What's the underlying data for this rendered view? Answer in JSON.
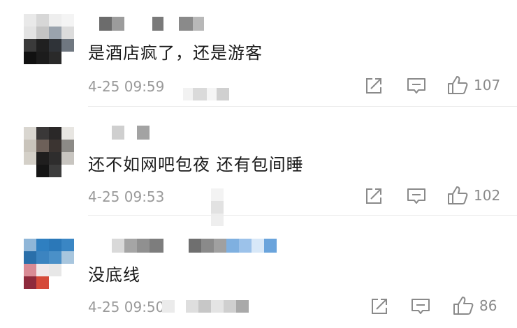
{
  "comments": [
    {
      "text": "是酒店疯了，还是游客",
      "time": "4-25 09:59",
      "likes": "107"
    },
    {
      "text": "还不如网吧包夜 还有包间睡",
      "time": "4-25 09:53",
      "likes": "102"
    },
    {
      "text": "没底线",
      "time": "4-25 09:50",
      "likes": "86"
    }
  ],
  "icons": {
    "repost": "repost-icon",
    "comment": "comment-icon",
    "like": "thumbs-up-icon"
  },
  "colors": {
    "text": "#1a1a1a",
    "meta": "#9a9a9a",
    "icon": "#8a8a8a"
  }
}
